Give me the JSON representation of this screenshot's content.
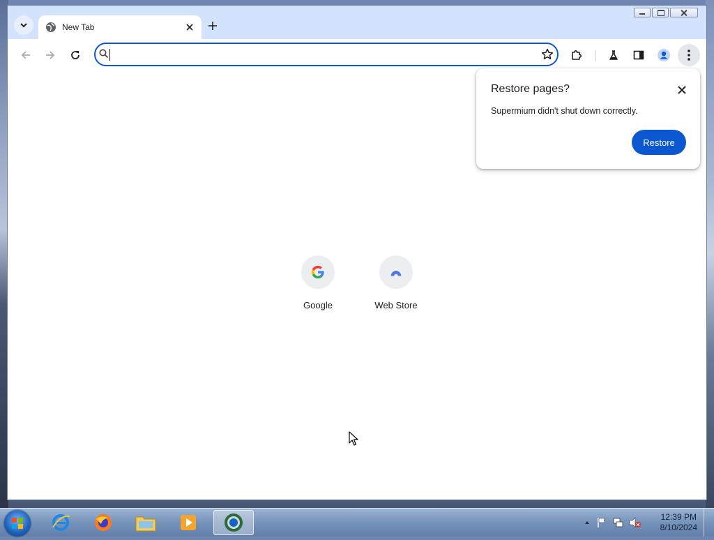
{
  "browser": {
    "tab": {
      "title": "New Tab"
    },
    "omnibox": {
      "value": "",
      "placeholder": ""
    }
  },
  "shortcuts": [
    {
      "label": "Google",
      "icon": "google-icon"
    },
    {
      "label": "Web Store",
      "icon": "web-store-icon"
    }
  ],
  "restore_bubble": {
    "title": "Restore pages?",
    "message": "Supermium didn't shut down correctly.",
    "button_label": "Restore"
  },
  "taskbar": {
    "apps": [
      "internet-explorer-icon",
      "firefox-icon",
      "file-explorer-icon",
      "media-player-icon",
      "supermium-icon"
    ],
    "clock": {
      "time": "12:39 PM",
      "date": "8/10/2024"
    }
  },
  "colors": {
    "accent": "#0b57d0",
    "tabstrip": "#d3e3fd"
  }
}
